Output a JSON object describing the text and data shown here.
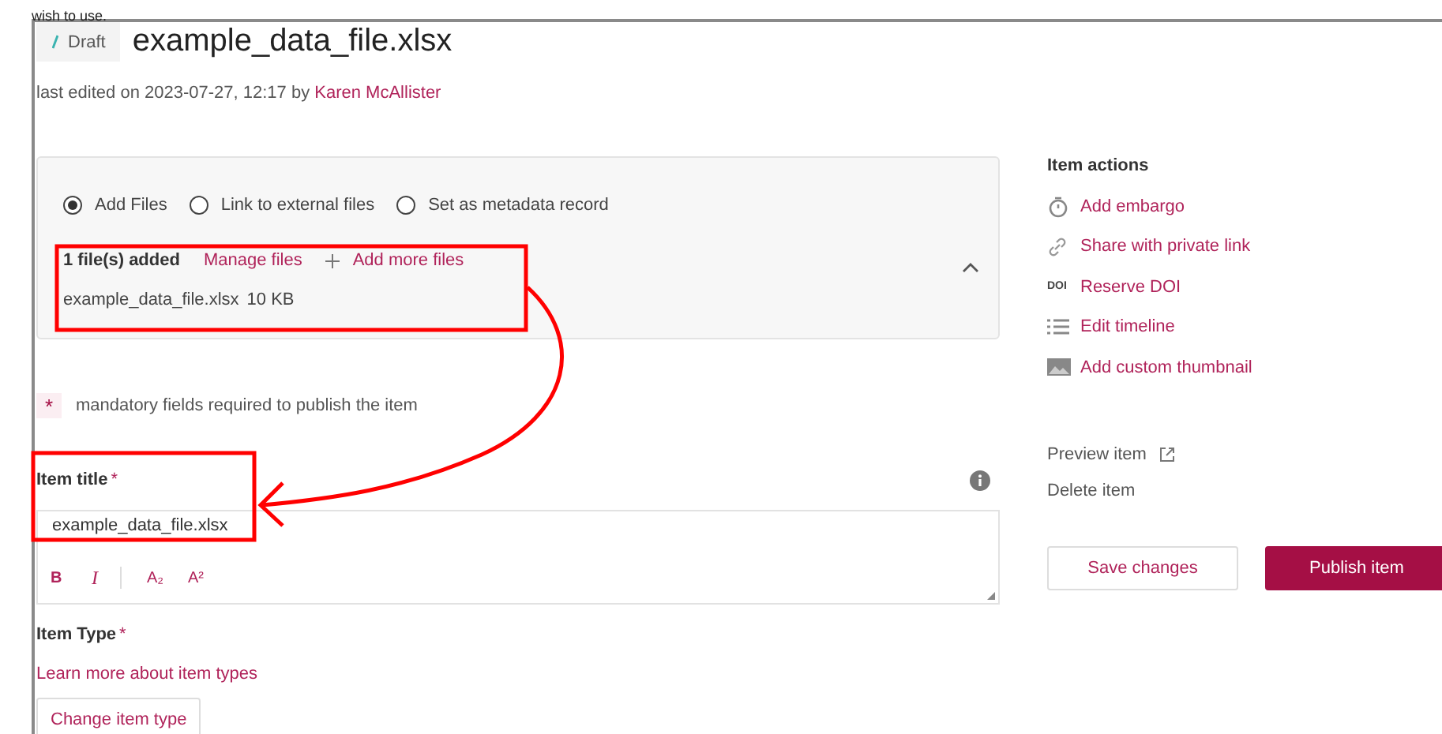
{
  "cut_heading": "wish to use.",
  "status_badge": "Draft",
  "title": "example_data_file.xlsx",
  "last_edited": {
    "text": "last edited on 2023-07-27, 12:17 by",
    "author": "Karen McAllister"
  },
  "file_options": [
    {
      "label": "Add Files",
      "selected": true
    },
    {
      "label": "Link to external files",
      "selected": false
    },
    {
      "label": "Set as metadata record",
      "selected": false
    }
  ],
  "files_panel": {
    "expanded": true,
    "count": "1 file(s) added",
    "manage": "Manage files",
    "add_more": "Add more files",
    "files": [
      {
        "name": "example_data_file.xlsx",
        "size": "10 KB"
      }
    ]
  },
  "mandatory_note": "mandatory fields required to publish the item",
  "item_title": {
    "label": "Item title",
    "required_mark": "*",
    "value": "example_data_file.xlsx",
    "toolbar": [
      {
        "kind": "bold",
        "label": "B"
      },
      {
        "kind": "italic",
        "label": "I"
      },
      {
        "kind": "subscript",
        "label": "A₂"
      },
      {
        "kind": "superscript",
        "label": "A²"
      }
    ]
  },
  "item_type": {
    "label": "Item Type",
    "required_mark": "*",
    "learn_more": "Learn more about item types",
    "change_button": "Change item type"
  },
  "item_actions": {
    "title": "Item actions",
    "actions": [
      {
        "kind": "timer",
        "label": "Add embargo"
      },
      {
        "kind": "link",
        "label": "Share with private link"
      },
      {
        "kind": "doi",
        "icon_text": "DOI",
        "label": "Reserve DOI"
      },
      {
        "kind": "list",
        "label": "Edit timeline"
      },
      {
        "kind": "image",
        "label": "Add custom thumbnail"
      }
    ]
  },
  "preview": "Preview item",
  "delete": "Delete item",
  "buttons": {
    "save": "Save changes",
    "publish": "Publish item"
  }
}
